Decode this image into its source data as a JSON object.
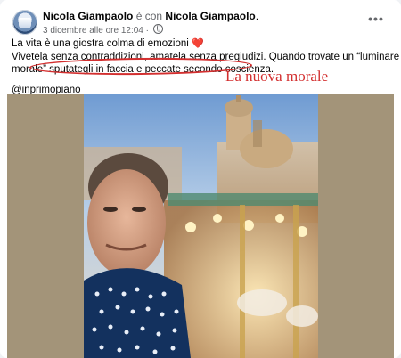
{
  "post": {
    "author": "Nicola Giampaolo",
    "with_word": "è con",
    "tagged": "Nicola Giampaolo",
    "tagged_suffix": ".",
    "timestamp": "3 dicembre alle ore 12:04 ·",
    "more_icon": "more-horizontal-icon",
    "lines": [
      "La vita è una giostra colma di emozioni",
      "Vivetela senza contraddizioni, amatela senza pregiudizi. Quando trovate un “luminare della",
      "morale” sputategli in faccia e peccate secondo coscienza."
    ],
    "heart": "❤️",
    "hashtag": "@inprimopiano"
  },
  "annotation": {
    "text": "La nuova morale",
    "color": "#d32f2f"
  },
  "colors": {
    "media_background": "#a39479",
    "name_text": "#050505",
    "meta_text": "#65676b"
  }
}
